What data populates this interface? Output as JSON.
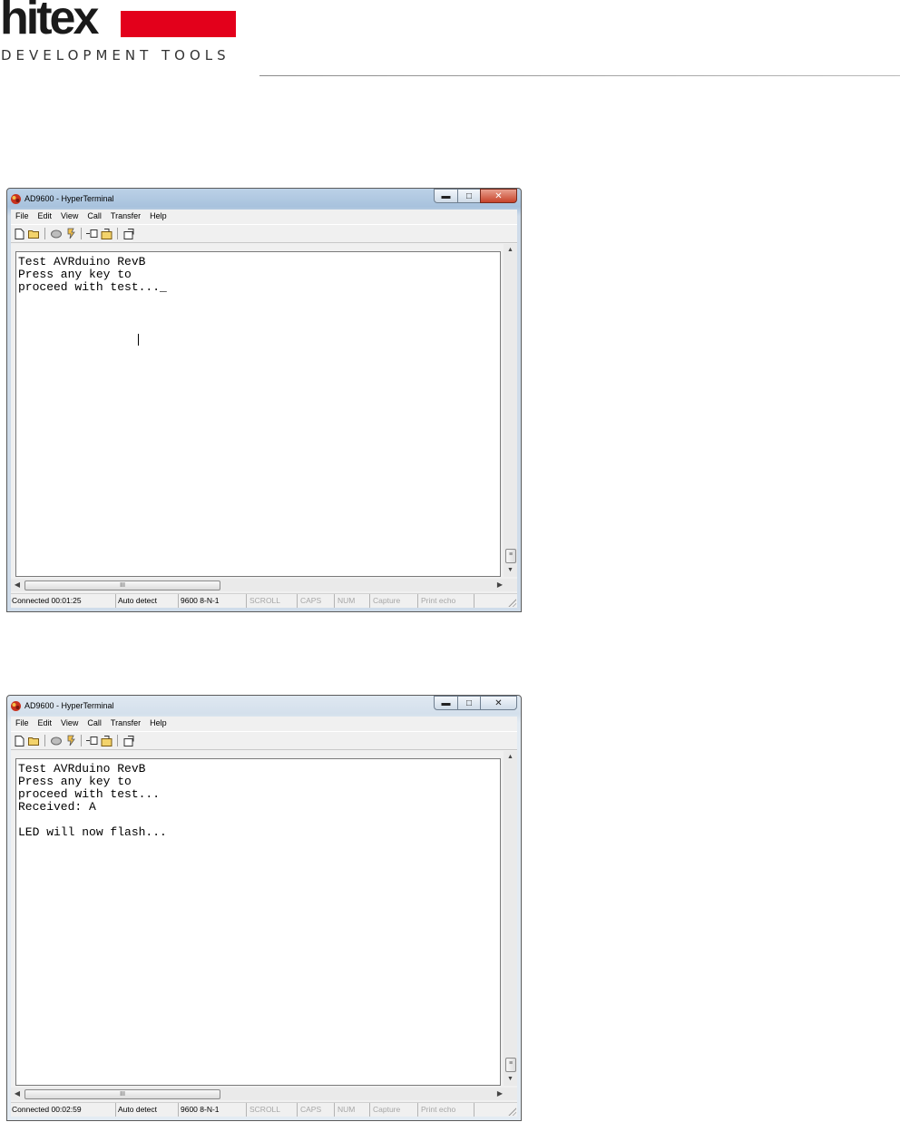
{
  "header": {
    "logo_word": "hitex",
    "logo_tagline": "DEVELOPMENT TOOLS",
    "brand_color": "#e3001b"
  },
  "windows": [
    {
      "title": "AD9600 - HyperTerminal",
      "menu": [
        "File",
        "Edit",
        "View",
        "Call",
        "Transfer",
        "Help"
      ],
      "terminal_lines": [
        "Test AVRduino RevB",
        "Press any key to",
        "proceed with test..._"
      ],
      "status": {
        "connected": "Connected 00:01:25",
        "detect": "Auto detect",
        "settings": "9600 8-N-1",
        "scroll": "SCROLL",
        "caps": "CAPS",
        "num": "NUM",
        "capture": "Capture",
        "print_echo": "Print echo"
      },
      "scrollbar_grip": "≡",
      "hscrollbar_grip": "III"
    },
    {
      "title": "AD9600 - HyperTerminal",
      "menu": [
        "File",
        "Edit",
        "View",
        "Call",
        "Transfer",
        "Help"
      ],
      "terminal_lines": [
        "Test AVRduino RevB",
        "Press any key to",
        "proceed with test...",
        "Received: A",
        "",
        "LED will now flash..."
      ],
      "status": {
        "connected": "Connected 00:02:59",
        "detect": "Auto detect",
        "settings": "9600 8-N-1",
        "scroll": "SCROLL",
        "caps": "CAPS",
        "num": "NUM",
        "capture": "Capture",
        "print_echo": "Print echo"
      },
      "scrollbar_grip": "≡",
      "hscrollbar_grip": "III"
    }
  ]
}
